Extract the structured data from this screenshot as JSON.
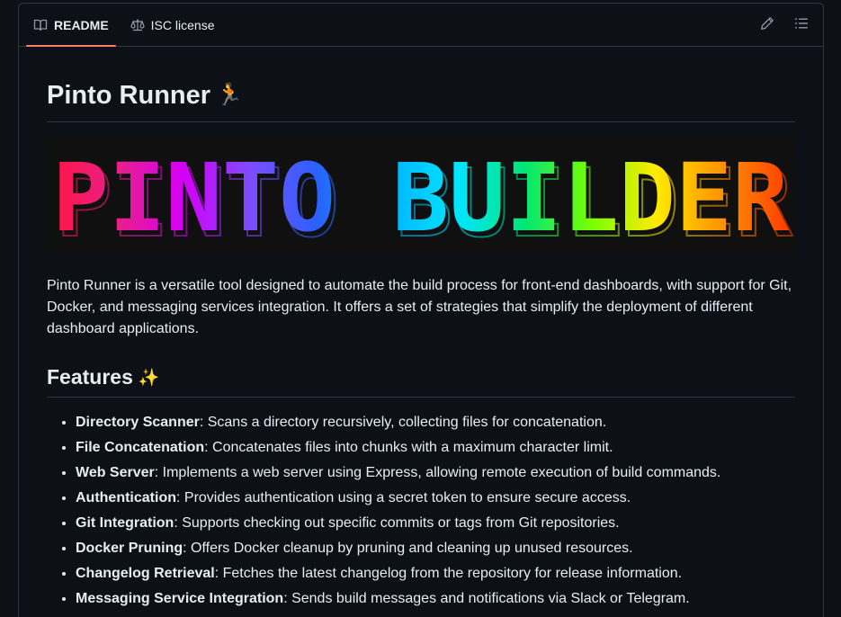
{
  "tabs": [
    {
      "label": "README",
      "icon": "book-icon",
      "active": true
    },
    {
      "label": "ISC license",
      "icon": "law-icon",
      "active": false
    }
  ],
  "actions": [
    {
      "icon": "pencil-icon"
    },
    {
      "icon": "list-unordered-icon"
    }
  ],
  "readme": {
    "title": "Pinto Runner",
    "title_emoji": "🏃",
    "banner_text": "PINTO BUILDER",
    "description": "Pinto Runner is a versatile tool designed to automate the build process for front-end dashboards, with support for Git, Docker, and messaging services integration. It offers a set of strategies that simplify the deployment of different dashboard applications.",
    "features_heading": "Features",
    "features_emoji": "✨",
    "features": [
      {
        "name": "Directory Scanner",
        "text": ": Scans a directory recursively, collecting files for concatenation."
      },
      {
        "name": "File Concatenation",
        "text": ": Concatenates files into chunks with a maximum character limit."
      },
      {
        "name": "Web Server",
        "text": ": Implements a web server using Express, allowing remote execution of build commands."
      },
      {
        "name": "Authentication",
        "text": ": Provides authentication using a secret token to ensure secure access."
      },
      {
        "name": "Git Integration",
        "text": ": Supports checking out specific commits or tags from Git repositories."
      },
      {
        "name": "Docker Pruning",
        "text": ": Offers Docker cleanup by pruning and cleaning up unused resources."
      },
      {
        "name": "Changelog Retrieval",
        "text": ": Fetches the latest changelog from the repository for release information."
      },
      {
        "name": "Messaging Service Integration",
        "text": ": Sends build messages and notifications via Slack or Telegram."
      }
    ]
  },
  "colors": {
    "accent_tab": "#f78166",
    "banner_gradient": [
      "#ff1744",
      "#e91e8c",
      "#d500f9",
      "#7c4dff",
      "#2962ff",
      "#00b0ff",
      "#00e5ff",
      "#00e676",
      "#76ff03",
      "#ffea00",
      "#ff9100",
      "#ff3d00"
    ]
  }
}
